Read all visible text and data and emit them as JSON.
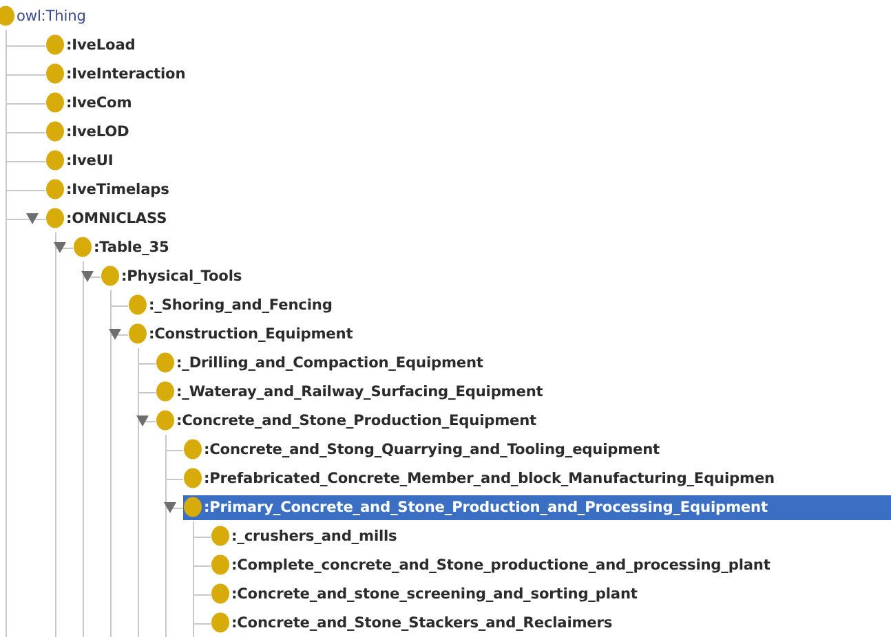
{
  "class_tree": {
    "label": "owl:Thing",
    "children": [
      {
        "label": ":IveLoad",
        "expanded": false,
        "selected": false
      },
      {
        "label": ":IveInteraction",
        "expanded": false,
        "selected": false
      },
      {
        "label": ":IveCom",
        "expanded": false,
        "selected": false
      },
      {
        "label": ":IveLOD",
        "expanded": false,
        "selected": false
      },
      {
        "label": ":IveUI",
        "expanded": false,
        "selected": false
      },
      {
        "label": ":IveTimelaps",
        "expanded": false,
        "selected": false
      },
      {
        "label": ":OMNICLASS",
        "expanded": true,
        "selected": false,
        "children": [
          {
            "label": ":Table_35",
            "expanded": true,
            "selected": false,
            "children": [
              {
                "label": ":Physical_Tools",
                "expanded": true,
                "selected": false,
                "children": [
                  {
                    "label": ":_Shoring_and_Fencing",
                    "expanded": false,
                    "selected": false
                  },
                  {
                    "label": ":Construction_Equipment",
                    "expanded": true,
                    "selected": false,
                    "children": [
                      {
                        "label": ":_Drilling_and_Compaction_Equipment",
                        "expanded": false,
                        "selected": false
                      },
                      {
                        "label": ":_Wateray_and_Railway_Surfacing_Equipment",
                        "expanded": false,
                        "selected": false
                      },
                      {
                        "label": ":Concrete_and_Stone_Production_Equipment",
                        "expanded": true,
                        "selected": false,
                        "children": [
                          {
                            "label": ":Concrete_and_Stong_Quarrying_and_Tooling_equipment",
                            "expanded": false,
                            "selected": false
                          },
                          {
                            "label": ":Prefabricated_Concrete_Member_and_block_Manufacturing_Equipmen",
                            "expanded": false,
                            "selected": false
                          },
                          {
                            "label": ":Primary_Concrete_and_Stone_Production_and_Processing_Equipment",
                            "expanded": true,
                            "selected": true,
                            "children": [
                              {
                                "label": ":_crushers_and_mills",
                                "expanded": false,
                                "selected": false
                              },
                              {
                                "label": ":Complete_concrete_and_Stone_productione_and_processing_plant",
                                "expanded": false,
                                "selected": false
                              },
                              {
                                "label": ":Concrete_and_stone_screening_and_sorting_plant",
                                "expanded": false,
                                "selected": false
                              },
                              {
                                "label": ":Concrete_and_Stone_Stackers_and_Reclaimers",
                                "expanded": false,
                                "selected": false
                              }
                            ]
                          }
                        ]
                      }
                    ]
                  }
                ]
              }
            ]
          }
        ]
      }
    ]
  }
}
